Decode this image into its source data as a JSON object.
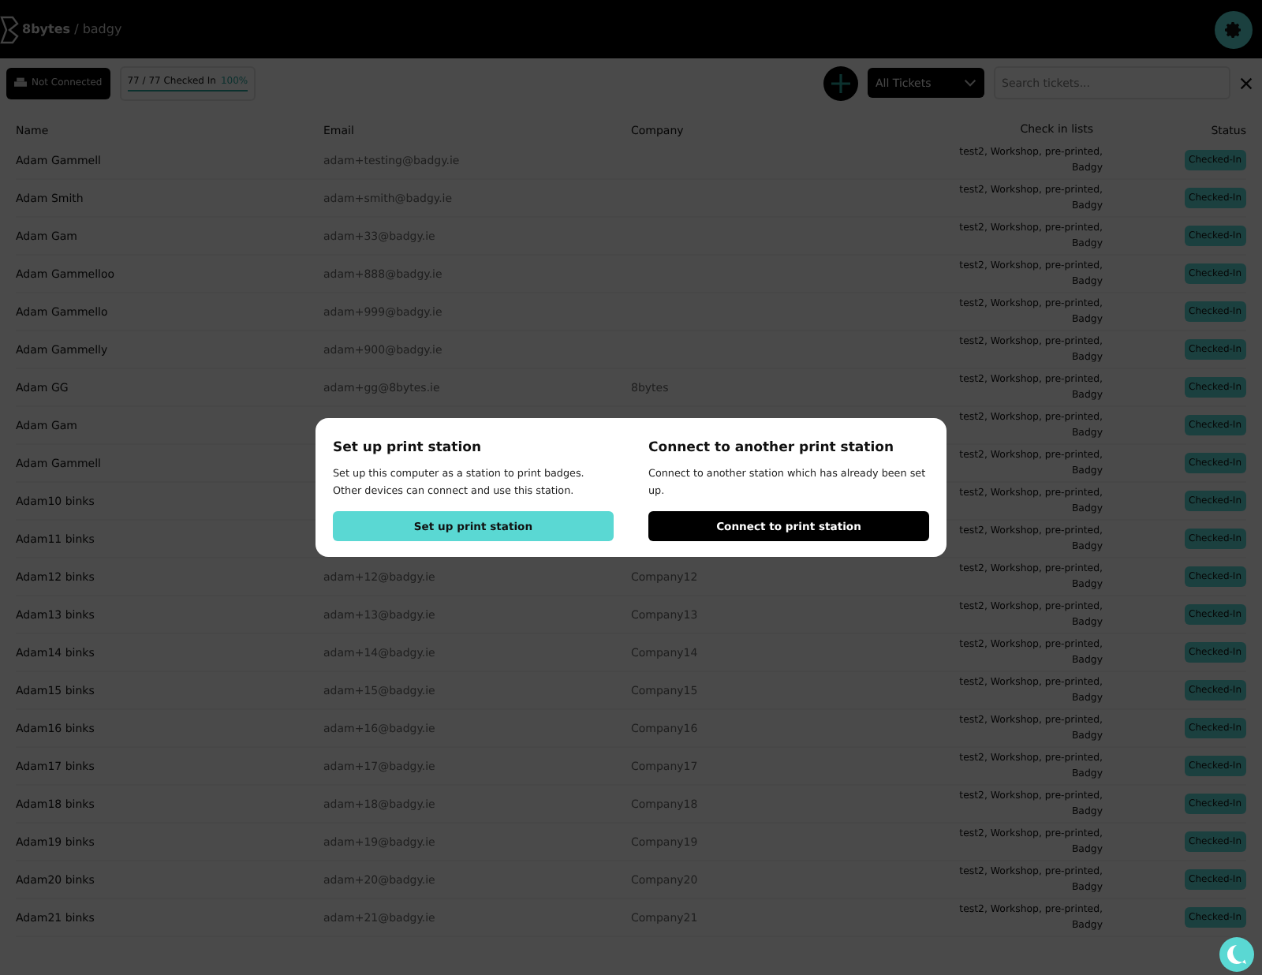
{
  "header": {
    "org": "8bytes",
    "separator": "/",
    "app": "badgy"
  },
  "toolbar": {
    "connection": "Not Connected",
    "checked_in": "77 / 77 Checked In",
    "percent": "100%",
    "level": 1,
    "filter": "All Tickets",
    "search": {
      "placeholder": "Search tickets..."
    }
  },
  "table": {
    "columns": [
      "Name",
      "Email",
      "Company",
      "Check in lists",
      "Status"
    ],
    "rows": [
      {
        "name": "Adam Gammell",
        "email": "adam+testing@badgy.ie",
        "check_in_lists": "test2, Workshop, pre-printed, Badgy",
        "status": "Checked-In"
      },
      {
        "name": "Adam Smith",
        "email": "adam+smith@badgy.ie",
        "check_in_lists": "test2, Workshop, pre-printed, Badgy",
        "status": "Checked-In"
      },
      {
        "name": "Adam Gam",
        "email": "adam+33@badgy.ie",
        "check_in_lists": "test2, Workshop, pre-printed, Badgy",
        "status": "Checked-In"
      },
      {
        "name": "Adam Gammelloo",
        "email": "adam+888@badgy.ie",
        "check_in_lists": "test2, Workshop, pre-printed, Badgy",
        "status": "Checked-In"
      },
      {
        "name": "Adam Gammello",
        "email": "adam+999@badgy.ie",
        "check_in_lists": "test2, Workshop, pre-printed, Badgy",
        "status": "Checked-In"
      },
      {
        "name": "Adam Gammelly",
        "email": "adam+900@badgy.ie",
        "check_in_lists": "test2, Workshop, pre-printed, Badgy",
        "status": "Checked-In"
      },
      {
        "name": "Adam GG",
        "email": "adam+gg@8bytes.ie",
        "company": "8bytes",
        "check_in_lists": "test2, Workshop, pre-printed, Badgy",
        "status": "Checked-In"
      },
      {
        "name": "Adam Gam",
        "check_in_lists": "test2, Workshop, pre-printed, Badgy",
        "status": "Checked-In"
      },
      {
        "name": "Adam Gammell",
        "check_in_lists": "test2, Workshop, pre-printed, Badgy",
        "status": "Checked-In"
      },
      {
        "name": "Adam10 binks",
        "check_in_lists": "test2, Workshop, pre-printed, Badgy",
        "status": "Checked-In"
      },
      {
        "name": "Adam11 binks",
        "check_in_lists": "test2, Workshop, pre-printed, Badgy",
        "status": "Checked-In"
      },
      {
        "name": "Adam12 binks",
        "email": "adam+12@badgy.ie",
        "company": "Company12",
        "check_in_lists": "test2, Workshop, pre-printed, Badgy",
        "status": "Checked-In"
      },
      {
        "name": "Adam13 binks",
        "email": "adam+13@badgy.ie",
        "company": "Company13",
        "check_in_lists": "test2, Workshop, pre-printed, Badgy",
        "status": "Checked-In"
      },
      {
        "name": "Adam14 binks",
        "email": "adam+14@badgy.ie",
        "company": "Company14",
        "check_in_lists": "test2, Workshop, pre-printed, Badgy",
        "status": "Checked-In"
      },
      {
        "name": "Adam15 binks",
        "email": "adam+15@badgy.ie",
        "company": "Company15",
        "check_in_lists": "test2, Workshop, pre-printed, Badgy",
        "status": "Checked-In"
      },
      {
        "name": "Adam16 binks",
        "email": "adam+16@badgy.ie",
        "company": "Company16",
        "check_in_lists": "test2, Workshop, pre-printed, Badgy",
        "status": "Checked-In"
      },
      {
        "name": "Adam17 binks",
        "email": "adam+17@badgy.ie",
        "company": "Company17",
        "check_in_lists": "test2, Workshop, pre-printed, Badgy",
        "status": "Checked-In"
      },
      {
        "name": "Adam18 binks",
        "email": "adam+18@badgy.ie",
        "company": "Company18",
        "check_in_lists": "test2, Workshop, pre-printed, Badgy",
        "status": "Checked-In"
      },
      {
        "name": "Adam19 binks",
        "email": "adam+19@badgy.ie",
        "company": "Company19",
        "check_in_lists": "test2, Workshop, pre-printed, Badgy",
        "status": "Checked-In"
      },
      {
        "name": "Adam20 binks",
        "email": "adam+20@badgy.ie",
        "company": "Company20",
        "check_in_lists": "test2, Workshop, pre-printed, Badgy",
        "status": "Checked-In"
      },
      {
        "name": "Adam21 binks",
        "email": "adam+21@badgy.ie",
        "company": "Company21",
        "check_in_lists": "test2, Workshop, pre-printed, Badgy",
        "status": "Checked-In"
      }
    ]
  },
  "dialog": {
    "options": [
      {
        "title": "Set up print station",
        "text": "Set up this computer as a station to print badges. Other devices can connect and use this station.",
        "button": "Set up print station",
        "kind": "primary"
      },
      {
        "title": "Connect to another print station",
        "text": "Connect to another station which has already been set up.",
        "button": "Connect to print station",
        "kind": "dark"
      }
    ]
  }
}
